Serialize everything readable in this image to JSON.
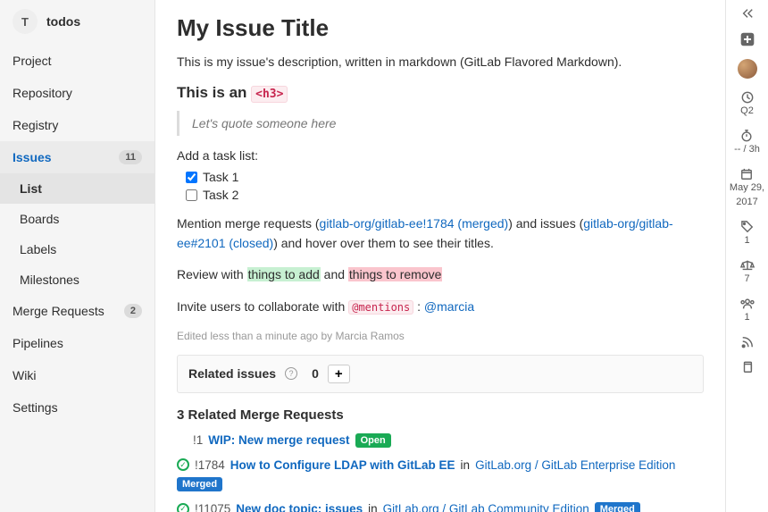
{
  "project": {
    "avatar_letter": "T",
    "name": "todos"
  },
  "sidebar": {
    "items": [
      {
        "label": "Project"
      },
      {
        "label": "Repository"
      },
      {
        "label": "Registry"
      },
      {
        "label": "Issues",
        "count": "11"
      },
      {
        "label": "Merge Requests",
        "count": "2"
      },
      {
        "label": "Pipelines"
      },
      {
        "label": "Wiki"
      },
      {
        "label": "Settings"
      }
    ],
    "issues_sub": [
      {
        "label": "List"
      },
      {
        "label": "Boards"
      },
      {
        "label": "Labels"
      },
      {
        "label": "Milestones"
      }
    ]
  },
  "issue": {
    "title": "My Issue Title",
    "description": "This is my issue's description, written in markdown (GitLab Flavored Markdown).",
    "h3_prefix": "This is an ",
    "h3_code": "<h3>",
    "blockquote": "Let's quote someone here",
    "task_intro": "Add a task list:",
    "tasks": [
      {
        "label": "Task 1",
        "checked": true
      },
      {
        "label": "Task 2",
        "checked": false
      }
    ],
    "mention_para": {
      "p1": "Mention merge requests (",
      "link1": "gitlab-org/gitlab-ee!1784 (merged)",
      "p2": ") and issues (",
      "link2": "gitlab-org/gitlab-ee#2101 (closed)",
      "p3": ") and hover over them to see their titles."
    },
    "diff_para": {
      "p1": "Review with ",
      "ins": "things to add",
      "p2": " and ",
      "del": "things to remove"
    },
    "invite_para": {
      "p1": "Invite users to collaborate with ",
      "code": "@mentions",
      "p2": " : ",
      "link": "@marcia"
    },
    "edited": "Edited less than a minute ago by Marcia Ramos"
  },
  "related": {
    "label": "Related issues",
    "count": "0"
  },
  "mr_section": {
    "title": "3 Related Merge Requests",
    "items": [
      {
        "ref": "!1",
        "title": "WIP: New merge request",
        "badge": "Open",
        "badge_type": "open",
        "in": "",
        "project": ""
      },
      {
        "ref": "!1784",
        "title": "How to Configure LDAP with GitLab EE",
        "badge": "Merged",
        "badge_type": "merged",
        "in": " in ",
        "project": "GitLab.org / GitLab Enterprise Edition"
      },
      {
        "ref": "!11075",
        "title": "New doc topic: issues",
        "badge": "Merged",
        "badge_type": "merged",
        "in": " in ",
        "project": "GitLab.org / GitLab Community Edition"
      }
    ]
  },
  "rail": {
    "milestone": "Q2",
    "time": "-- / 3h",
    "date_line1": "May 29,",
    "date_line2": "2017",
    "labels_count": "1",
    "weight": "7",
    "participants": "1"
  }
}
